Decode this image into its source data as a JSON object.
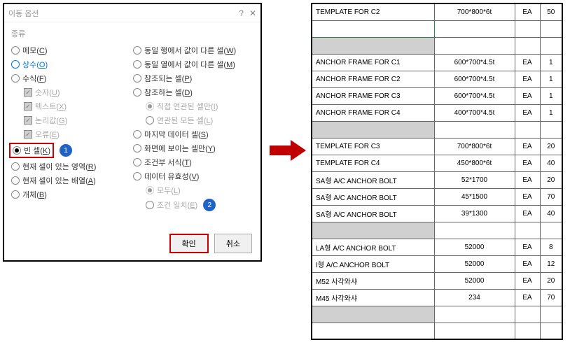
{
  "dialog": {
    "title": "이동 옵션",
    "group_label": "종류",
    "left_options": {
      "memo": {
        "label": "메모(",
        "key": "C",
        "suffix": ")"
      },
      "constants": {
        "label": "상수(",
        "key": "O",
        "suffix": ")"
      },
      "formula": {
        "label": "수식(",
        "key": "F",
        "suffix": ")"
      },
      "numbers": {
        "label": "숫자(",
        "key": "U",
        "suffix": ")"
      },
      "text": {
        "label": "텍스트(",
        "key": "X",
        "suffix": ")"
      },
      "logic": {
        "label": "논리값(",
        "key": "G",
        "suffix": ")"
      },
      "errors": {
        "label": "오류(",
        "key": "E",
        "suffix": ")"
      },
      "blanks": {
        "label": "빈 셀(",
        "key": "K",
        "suffix": ")"
      },
      "current_region": {
        "label": "현재 셀이 있는 영역(",
        "key": "R",
        "suffix": ")"
      },
      "current_array": {
        "label": "현재 셀이 있는 배열(",
        "key": "A",
        "suffix": ")"
      },
      "objects": {
        "label": "개체(",
        "key": "B",
        "suffix": ")"
      }
    },
    "right_options": {
      "row_diff": {
        "label": "동일 행에서 값이 다른 셀(",
        "key": "W",
        "suffix": ")"
      },
      "col_diff": {
        "label": "동일 열에서 값이 다른 셀(",
        "key": "M",
        "suffix": ")"
      },
      "precedents": {
        "label": "참조되는 셀(",
        "key": "P",
        "suffix": ")"
      },
      "dependents": {
        "label": "참조하는 셀(",
        "key": "D",
        "suffix": ")"
      },
      "direct_only": {
        "label": "직접 연관된 셀만(",
        "key": "I",
        "suffix": ")"
      },
      "all_levels": {
        "label": "연관된 모든 셀(",
        "key": "L",
        "suffix": ")"
      },
      "last_cell": {
        "label": "마지막 데이터 셀(",
        "key": "S",
        "suffix": ")"
      },
      "visible_cells": {
        "label": "화면에 보이는 셀만(",
        "key": "Y",
        "suffix": ")"
      },
      "cond_fmt": {
        "label": "조건부 서식(",
        "key": "T",
        "suffix": ")"
      },
      "data_val": {
        "label": "데이터 유효성(",
        "key": "V",
        "suffix": ")"
      },
      "all": {
        "label": "모두(",
        "key": "L",
        "suffix": ")"
      },
      "same": {
        "label": "조건 일치(",
        "key": "E",
        "suffix": ")"
      }
    },
    "badges": {
      "one": "1",
      "two": "2"
    },
    "buttons": {
      "ok": "확인",
      "cancel": "취소"
    }
  },
  "table": {
    "rows": [
      {
        "c1": "TEMPLATE FOR C2",
        "c2": "700*800*6t",
        "c3": "EA",
        "c4": "50"
      },
      {
        "selected": true
      },
      {
        "shaded": true
      },
      {
        "c1": "ANCHOR FRAME FOR C1",
        "c2": "600*700*4.5t",
        "c3": "EA",
        "c4": "1"
      },
      {
        "c1": "ANCHOR FRAME FOR C2",
        "c2": "600*700*4.5t",
        "c3": "EA",
        "c4": "1"
      },
      {
        "c1": "ANCHOR FRAME FOR C3",
        "c2": "600*700*4.5t",
        "c3": "EA",
        "c4": "1"
      },
      {
        "c1": "ANCHOR FRAME FOR C4",
        "c2": "400*700*4.5t",
        "c3": "EA",
        "c4": "1"
      },
      {
        "shaded": true
      },
      {
        "c1": "TEMPLATE FOR C3",
        "c2": "700*800*6t",
        "c3": "EA",
        "c4": "20"
      },
      {
        "c1": "TEMPLATE FOR C4",
        "c2": "450*800*6t",
        "c3": "EA",
        "c4": "40"
      },
      {
        "c1": "SA형 A/C ANCHOR BOLT",
        "c2": "52*1700",
        "c3": "EA",
        "c4": "20"
      },
      {
        "c1": "SA형 A/C ANCHOR BOLT",
        "c2": "45*1500",
        "c3": "EA",
        "c4": "70"
      },
      {
        "c1": "SA형 A/C ANCHOR BOLT",
        "c2": "39*1300",
        "c3": "EA",
        "c4": "40"
      },
      {
        "shaded": true
      },
      {
        "c1": "LA형 A/C ANCHOR BOLT",
        "c2": "52000",
        "c3": "EA",
        "c4": "8"
      },
      {
        "c1": "I형 A/C ANCHOR BOLT",
        "c2": "52000",
        "c3": "EA",
        "c4": "12"
      },
      {
        "c1": "M52 사각와샤",
        "c2": "52000",
        "c3": "EA",
        "c4": "20"
      },
      {
        "c1": "M45 사각와샤",
        "c2": "234",
        "c3": "EA",
        "c4": "70"
      },
      {
        "shaded": true
      },
      {
        "empty": true
      }
    ]
  }
}
